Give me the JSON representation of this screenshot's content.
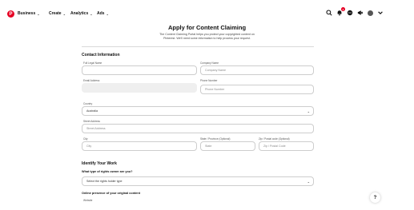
{
  "nav": {
    "logo": "P",
    "items": [
      {
        "label": "Business"
      },
      {
        "label": "Create"
      },
      {
        "label": "Analytics"
      },
      {
        "label": "Ads"
      }
    ],
    "notifications_count": "1",
    "chevron": "⌄"
  },
  "header": {
    "title": "Apply for Content Claiming",
    "subtitle_line1": "The Content Claiming Portal helps you protect your copyrighted content on",
    "subtitle_line2": "Pinterest. We'll need some information to help process your request."
  },
  "contact": {
    "heading": "Contact Information",
    "full_legal_name_label": "Full Legal Name",
    "full_legal_name_value": "",
    "company_name_label": "Company Name",
    "company_name_placeholder": "Company Name",
    "email_label": "Email Address",
    "email_value": "",
    "phone_label": "Phone Number",
    "phone_placeholder": "Phone Number",
    "country_label": "Country",
    "country_value": "Australia",
    "street_label": "Street Address",
    "street_placeholder": "Street Address",
    "city_label": "City",
    "city_placeholder": "City",
    "state_label": "State / Province (Optional)",
    "state_placeholder": "State",
    "zip_label": "Zip / Postal code (Optional)",
    "zip_placeholder": "Zip / Postal Code"
  },
  "work": {
    "heading": "Identify Your Work",
    "rights_question": "What type of rights owner are you?",
    "rights_select_value": "Select the rights holder type",
    "presence_question": "Online presence of your original content",
    "website_label": "Website"
  },
  "help": {
    "label": "?"
  }
}
